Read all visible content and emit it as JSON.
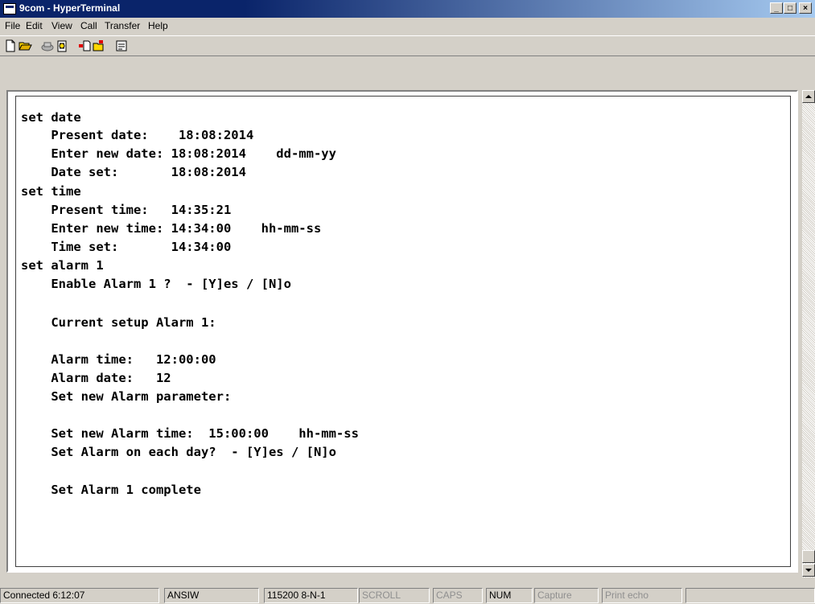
{
  "window": {
    "title": "9com - HyperTerminal",
    "minimize": "_",
    "maximize": "□",
    "close": "×"
  },
  "menu": [
    "File",
    "Edit",
    "View",
    "Call",
    "Transfer",
    "Help"
  ],
  "toolbar_icons": [
    "new-icon",
    "open-icon",
    "disconnect-icon",
    "dial-icon",
    "send-icon",
    "receive-icon",
    "properties-icon"
  ],
  "terminal": {
    "lines": [
      "set date",
      "    Present date:    18:08:2014",
      "    Enter new date: 18:08:2014    dd-mm-yy",
      "    Date set:       18:08:2014",
      "set time",
      "    Present time:   14:35:21",
      "    Enter new time: 14:34:00    hh-mm-ss",
      "    Time set:       14:34:00",
      "set alarm 1",
      "    Enable Alarm 1 ?  - [Y]es / [N]o",
      "",
      "    Current setup Alarm 1:",
      "",
      "    Alarm time:   12:00:00",
      "    Alarm date:   12",
      "    Set new Alarm parameter:",
      "",
      "    Set new Alarm time:  15:00:00    hh-mm-ss",
      "    Set Alarm on each day?  - [Y]es / [N]o",
      "",
      "    Set Alarm 1 complete"
    ]
  },
  "status": {
    "connected": "Connected 6:12:07",
    "emulation": "ANSIW",
    "port": "115200 8-N-1",
    "scroll": "SCROLL",
    "caps": "CAPS",
    "num": "NUM",
    "capture": "Capture",
    "print_echo": "Print echo"
  }
}
